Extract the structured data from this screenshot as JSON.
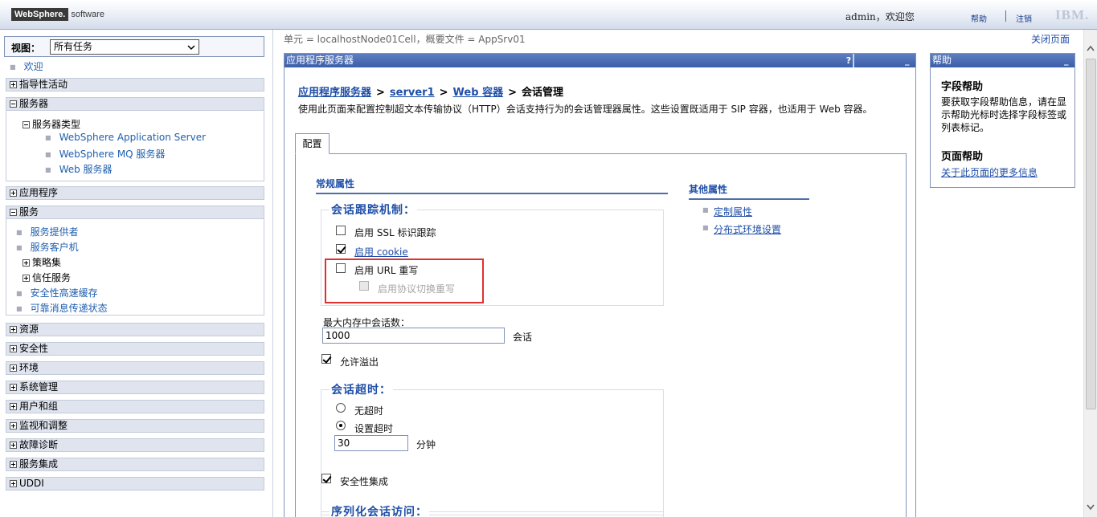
{
  "banner": {
    "brand": "WebSphere.",
    "software": "software",
    "welcome": "admin，欢迎您",
    "help": "帮助",
    "logout": "注销",
    "ibm": "IBM."
  },
  "nav": {
    "view_label": "视图：",
    "view_value": "所有任务",
    "welcome": "欢迎",
    "guided": "指导性活动",
    "servers": "服务器",
    "server_types": "服务器类型",
    "server_items": [
      "WebSphere Application Server",
      "WebSphere MQ 服务器",
      "Web 服务器"
    ],
    "applications": "应用程序",
    "services": "服务",
    "service_providers": "服务提供者",
    "service_clients": "服务客户机",
    "policy_sets": "策略集",
    "trust_service": "信任服务",
    "security_cache": "安全性高速缓存",
    "reliable_messaging": "可靠消息传递状态",
    "resources": "资源",
    "security": "安全性",
    "environment": "环境",
    "system_admin": "系统管理",
    "users_groups": "用户和组",
    "monitoring": "监视和调整",
    "troubleshooting": "故障诊断",
    "service_integration": "服务集成",
    "uddi": "UDDI"
  },
  "main": {
    "cell_info": "单元 = localhostNode01Cell，概要文件 = AppSrv01",
    "close_page": "关闭页面",
    "panel_title": "应用程序服务器",
    "panel_help": "?",
    "panel_min": "_",
    "crumbs": {
      "c1": "应用程序服务器",
      "c2": "server1",
      "c3": "Web 容器",
      "current": "会话管理",
      "sep": ">"
    },
    "description": "使用此页面来配置控制超文本传输协议（HTTP）会话支持行为的会话管理器属性。这些设置既适用于 SIP 容器，也适用于 Web 容器。",
    "tab": "配置",
    "general_props": "常规属性",
    "tracking": {
      "legend": "会话跟踪机制：",
      "ssl": "启用 SSL 标识跟踪",
      "cookie": "启用 cookie",
      "url": "启用 URL 重写",
      "protocol": "启用协议切换重写"
    },
    "max_sessions_label": "最大内存中会话数：",
    "max_sessions_value": "1000",
    "sessions_unit": "会话",
    "allow_overflow": "允许溢出",
    "timeout": {
      "legend": "会话超时：",
      "none": "无超时",
      "set": "设置超时",
      "value": "30",
      "unit": "分钟"
    },
    "security_integration": "安全性集成",
    "serialize_legend": "序列化会话访问：",
    "other_props": "其他属性",
    "other_links": [
      "定制属性",
      "分布式环境设置"
    ]
  },
  "help": {
    "title": "帮助",
    "min": "_",
    "field_head": "字段帮助",
    "field_text": "要获取字段帮助信息，请在显示帮助光标时选择字段标签或列表标记。",
    "page_head": "页面帮助",
    "page_link": "关于此页面的更多信息"
  }
}
